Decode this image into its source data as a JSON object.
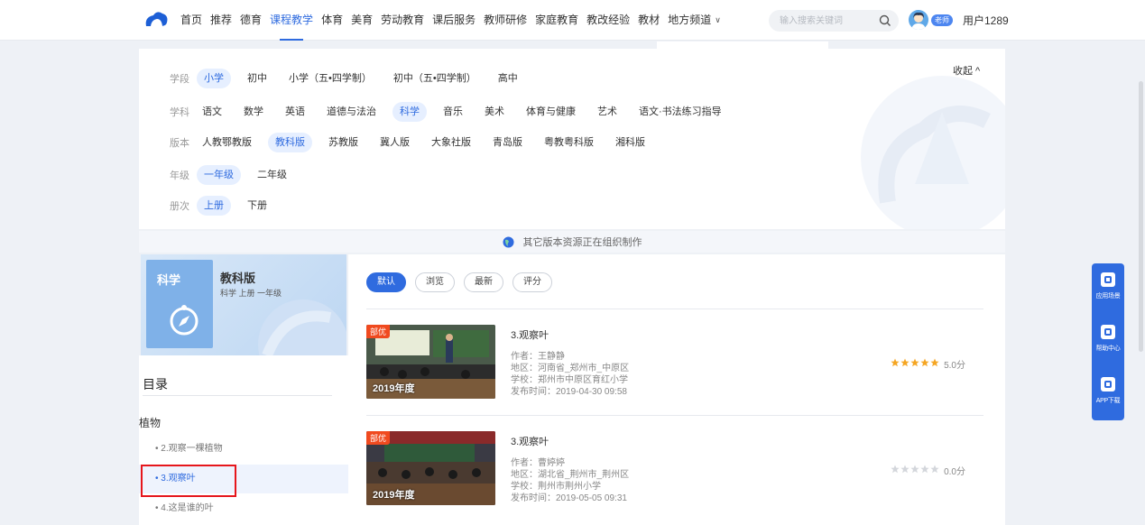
{
  "nav": {
    "items": [
      "首页",
      "推荐",
      "德育",
      "课程教学",
      "体育",
      "美育",
      "劳动教育",
      "课后服务",
      "教师研修",
      "家庭教育",
      "教改经验",
      "教材"
    ],
    "active_index": 3,
    "local_channel": "地方频道"
  },
  "search": {
    "placeholder": "输入搜索关键词"
  },
  "user": {
    "role": "老师",
    "name": "用户1289"
  },
  "filters": {
    "collapse_label": "收起 ^",
    "rows": [
      {
        "label": "学段",
        "options": [
          "小学",
          "初中",
          "小学（五•四学制）",
          "初中（五•四学制）",
          "高中"
        ],
        "selected": 0
      },
      {
        "label": "学科",
        "options": [
          "语文",
          "数学",
          "英语",
          "道德与法治",
          "科学",
          "音乐",
          "美术",
          "体育与健康",
          "艺术",
          "语文·书法练习指导"
        ],
        "selected": 4
      },
      {
        "label": "版本",
        "options": [
          "人教鄂教版",
          "教科版",
          "苏教版",
          "冀人版",
          "大象社版",
          "青岛版",
          "粤教粤科版",
          "湘科版"
        ],
        "selected": 1
      },
      {
        "label": "年级",
        "options": [
          "一年级",
          "二年级"
        ],
        "selected": 0
      },
      {
        "label": "册次",
        "options": [
          "上册",
          "下册"
        ],
        "selected": 0
      }
    ]
  },
  "notice": "其它版本资源正在组织制作",
  "book": {
    "cover_title": "科学",
    "name": "教科版",
    "subtitle": "科学 上册 一年级"
  },
  "toc": {
    "title": "目录",
    "group": "植物",
    "items": [
      {
        "label": "• 2.观察一棵植物"
      },
      {
        "label": "• 3.观察叶"
      },
      {
        "label": "• 4.这是谁的叶"
      }
    ],
    "active_index": 1
  },
  "sort_tabs": [
    "默认",
    "浏览",
    "最新",
    "评分"
  ],
  "sort_selected": 0,
  "lessons": [
    {
      "badge": "部优",
      "year": "2019年度",
      "title": "3.观察叶",
      "author": "作者：王静静",
      "region": "地区：河南省_郑州市_中原区",
      "school": "学校：郑州市中原区育红小学",
      "published": "发布时间：2019-04-30 09:58",
      "rating_value": 5.0,
      "score": "5.0分",
      "star_color": "#f5a623"
    },
    {
      "badge": "部优",
      "year": "2019年度",
      "title": "3.观察叶",
      "author": "作者：曹婷婷",
      "region": "地区：湖北省_荆州市_荆州区",
      "school": "学校：荆州市荆州小学",
      "published": "发布时间：2019-05-05 09:31",
      "rating_value": 0.0,
      "score": "0.0分",
      "star_color": "#d3d6db"
    }
  ],
  "side_tools": [
    {
      "label": "应用场景",
      "icon": "scene-icon"
    },
    {
      "label": "帮助中心",
      "icon": "help-icon"
    },
    {
      "label": "APP下载",
      "icon": "download-icon"
    }
  ],
  "colors": {
    "accent": "#2f6bdf",
    "badge": "#f04a1f",
    "highlight": "#e6161c"
  }
}
